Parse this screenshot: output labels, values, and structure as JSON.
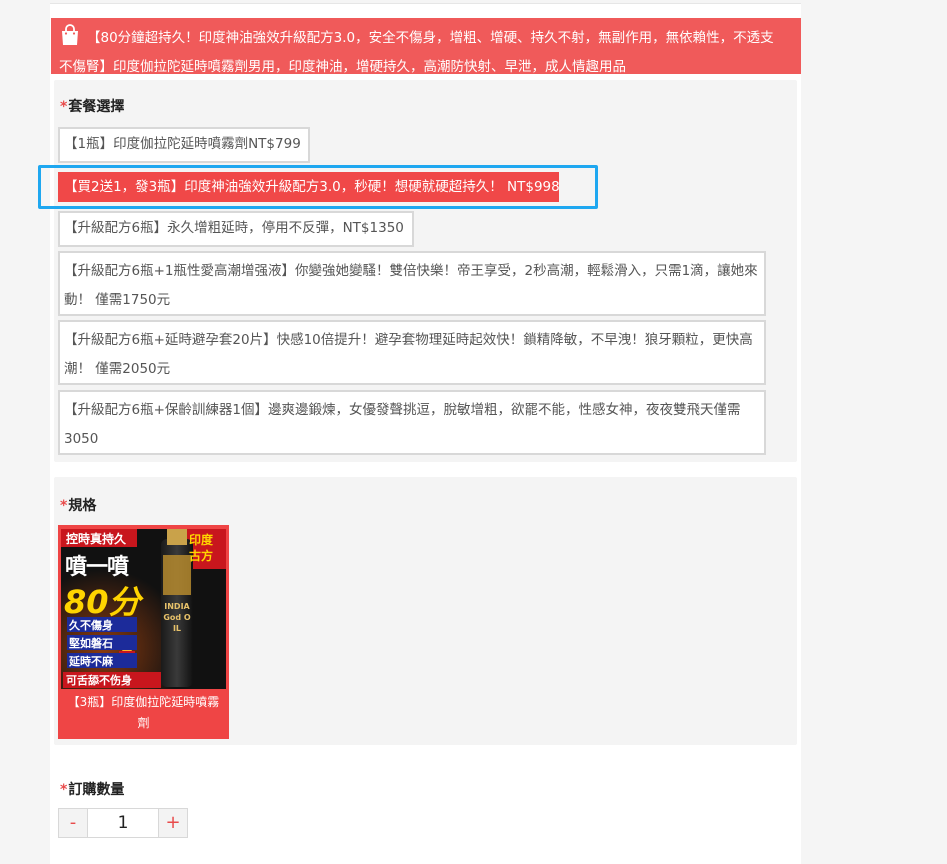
{
  "banner": {
    "title": "【80分鐘超持久！印度神油強效升級配方3.0，安全不傷身，增粗、增硬、持久不射，無副作用，無依賴性，不透支不傷腎】印度伽拉陀延時噴霧劑男用，印度神油，增硬持久，高潮防快射、早泄，成人情趣用品",
    "icon": "shopping-bag-icon"
  },
  "package": {
    "label": "套餐選擇",
    "required_mark": "*",
    "options": [
      {
        "label": "【1瓶】印度伽拉陀延時噴霧劑NT$799",
        "selected": false
      },
      {
        "label": "【買2送1，發3瓶】印度神油強效升級配方3.0，秒硬！想硬就硬超持久！ NT$998",
        "selected": true
      },
      {
        "label": "【升級配方6瓶】永久增粗延時，停用不反彈，NT$1350",
        "selected": false
      },
      {
        "label": "【升級配方6瓶+1瓶性愛高潮增强液】你變強她變騷！雙倍快樂！帝王享受，2秒高潮，輕鬆滑入，只需1滴，讓她來動！ 僅需1750元",
        "selected": false
      },
      {
        "label": "【升級配方6瓶+延時避孕套20片】快感10倍提升！避孕套物理延時起效快！鎖精降敏，不早洩！狼牙顆粒，更快高潮！ 僅需2050元",
        "selected": false
      },
      {
        "label": "【升級配方6瓶+保齡訓練器1個】邊爽邊鍛煉，女優發聲挑逗，脫敏增粗，欲罷不能，性感女神，夜夜雙飛天僅需3050",
        "selected": false
      }
    ]
  },
  "spec": {
    "label": "規格",
    "required_mark": "*",
    "card_caption": "【3瓶】印度伽拉陀延時噴霧劑",
    "image_text": {
      "top": "控時真持久",
      "big": "噴一噴",
      "num": "80分",
      "tag1": "久不傷身",
      "tag2": "堅如磐石",
      "tag3": "延時不麻",
      "bottom": "可舌舔不伤身",
      "badge": "印度古方",
      "bottle": "INDIA God OIL"
    }
  },
  "quantity": {
    "label": "訂購數量",
    "required_mark": "*",
    "minus": "-",
    "plus": "+",
    "value": "1"
  },
  "colors": {
    "accent": "#f04848",
    "focus": "#1ea7f0"
  }
}
